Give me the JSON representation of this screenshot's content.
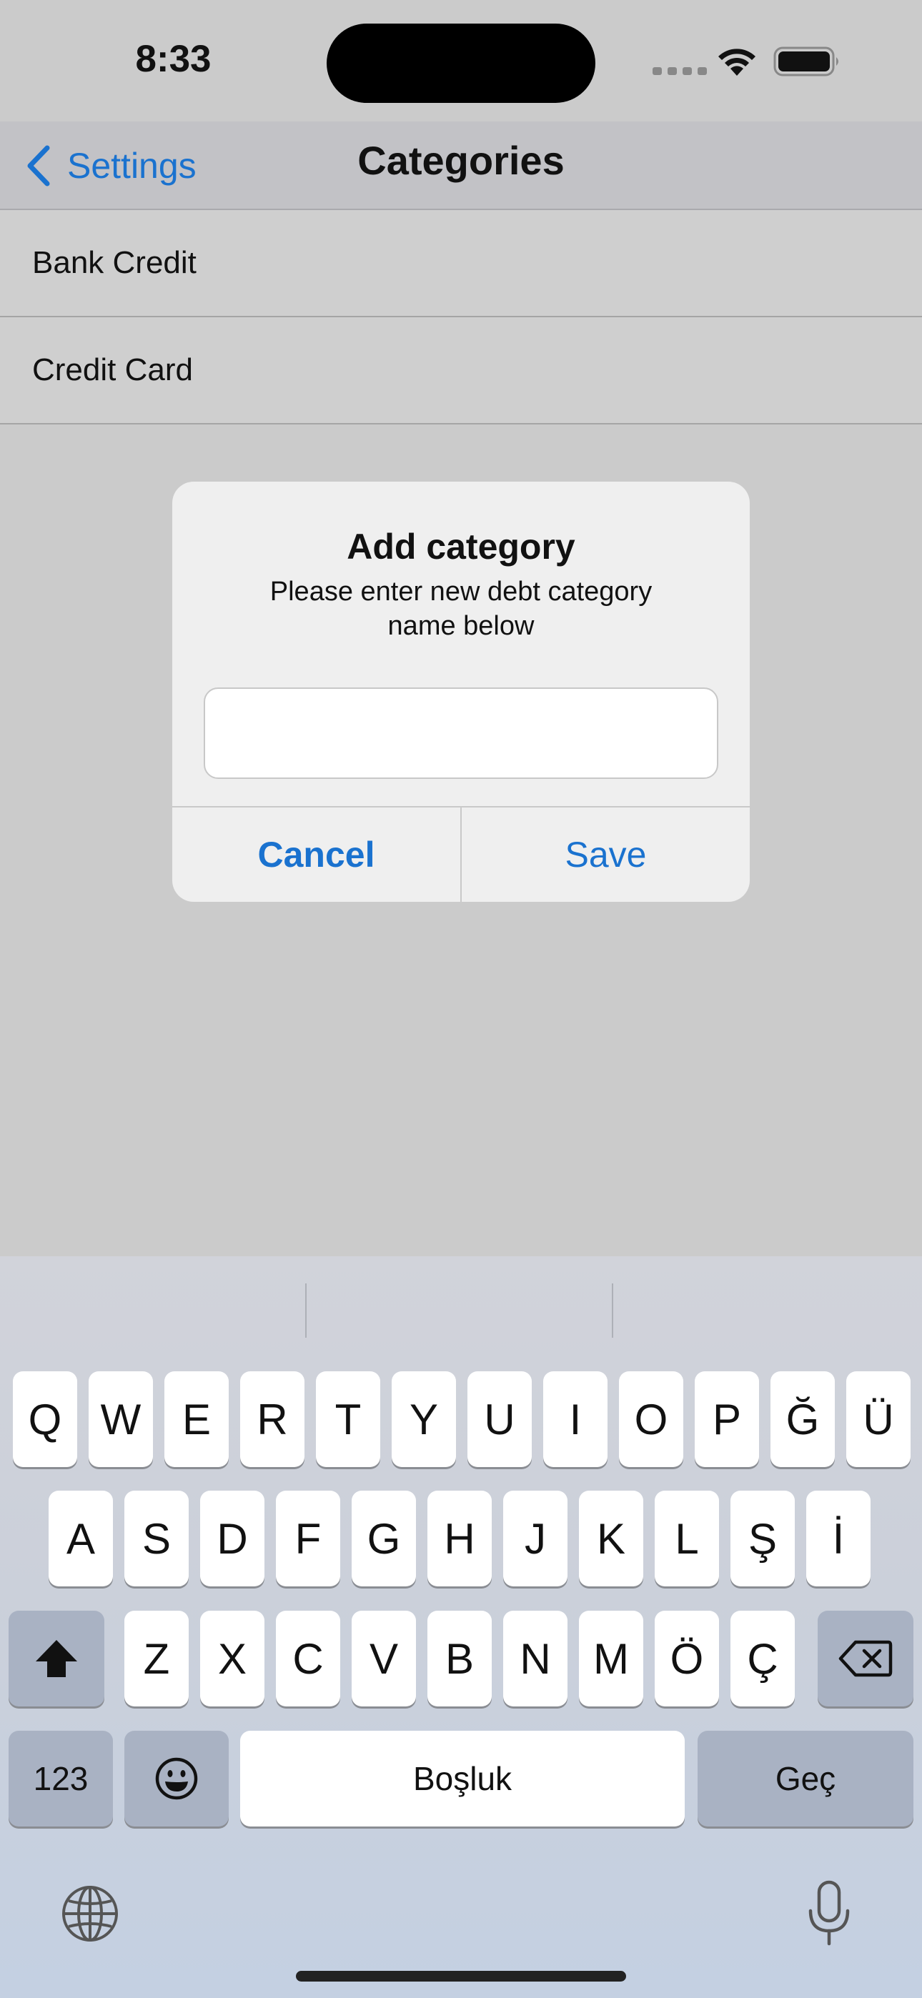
{
  "status_bar": {
    "time": "8:33"
  },
  "nav": {
    "back_label": "Settings",
    "title": "Categories"
  },
  "categories": [
    {
      "label": "Bank Credit"
    },
    {
      "label": "Credit Card"
    }
  ],
  "alert": {
    "title": "Add category",
    "message": "Please enter new debt category name below",
    "input_value": "",
    "cancel_label": "Cancel",
    "save_label": "Save"
  },
  "keyboard": {
    "row1": [
      "Q",
      "W",
      "E",
      "R",
      "T",
      "Y",
      "U",
      "I",
      "O",
      "P",
      "Ğ",
      "Ü"
    ],
    "row2": [
      "A",
      "S",
      "D",
      "F",
      "G",
      "H",
      "J",
      "K",
      "L",
      "Ş",
      "İ"
    ],
    "row3": [
      "Z",
      "X",
      "C",
      "V",
      "B",
      "N",
      "M",
      "Ö",
      "Ç"
    ],
    "numbers_label": "123",
    "space_label": "Boşluk",
    "return_label": "Geç"
  },
  "icons": {
    "back": "chevron-left-icon",
    "wifi": "wifi-icon",
    "battery": "battery-icon",
    "shift": "shift-icon",
    "delete": "delete-backspace-icon",
    "emoji": "emoji-icon",
    "globe": "globe-icon",
    "microphone": "microphone-icon"
  },
  "colors": {
    "accent": "#1a72cf",
    "background": "#cbcbcb",
    "alert_background": "#efefef"
  }
}
